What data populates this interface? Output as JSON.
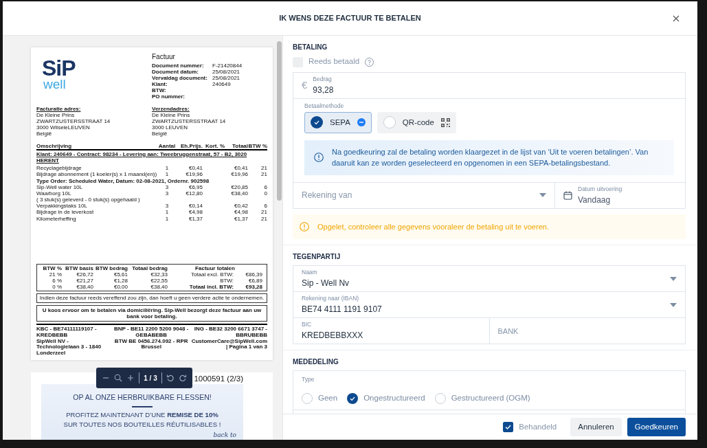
{
  "modal": {
    "title": "IK WENS DEZE FACTUUR TE BETALEN"
  },
  "invoice": {
    "logo": {
      "wordmark": "SiP",
      "tagline": "well"
    },
    "title": "Factuur",
    "meta": [
      {
        "label": "Document nummer:",
        "value": "F-21420844"
      },
      {
        "label": "Document datum:",
        "value": "25/08/2021"
      },
      {
        "label": "Vervaldag document:",
        "value": "25/08/2021"
      },
      {
        "label": "Klant:",
        "value": "240649"
      },
      {
        "label": "BTW:"
      },
      {
        "label": "PO nummer:"
      }
    ],
    "billing_address": {
      "heading": "Facturatie adres:",
      "lines": [
        "De Kleine Prins",
        "ZWARTZUSTERSSTRAAT 14",
        "3000 WilseleLEUVEN",
        "België"
      ]
    },
    "shipping_address": {
      "heading": "Verzendadres:",
      "lines": [
        "De Kleine Prins",
        "ZWARTZUSTERSSTRAAT 14",
        "3000 LEUVEN",
        "België"
      ]
    },
    "table": {
      "columns": [
        "Omschrijving",
        "Aantal",
        "Eh.Prijs.",
        "Kort. %",
        "Totaal",
        "BTW %"
      ],
      "rows": [
        {
          "kind": "group",
          "text": "Klant: 240649 - Contract: 98234 - Levering aan: Tweebruggenstraat, 57 - B2, 3020 HERENT"
        },
        {
          "kind": "item",
          "description": "Recyclagebijdrage",
          "quantity": "1",
          "unit_price": "€0,41",
          "total": "€0,41",
          "vat": "21"
        },
        {
          "kind": "item",
          "description": "Bijdrage abonnement (1 koeler(s) x 1 maand(en))",
          "quantity": "1",
          "unit_price": "€19,96",
          "total": "€19,96",
          "vat": "21"
        },
        {
          "kind": "order",
          "text": "Type Order: Scheduled Water, Datum: 02-08-2021, Ordernr. 902598"
        },
        {
          "kind": "item",
          "description": "Sip-Well water 10L",
          "quantity": "3",
          "unit_price": "€6,95",
          "total": "€20,85",
          "vat": "6"
        },
        {
          "kind": "item",
          "description": "Waarborg 10L",
          "note": "( 3 stuk(s) geleverd - 0 stuk(s) opgehaald )",
          "quantity": "3",
          "unit_price": "€12,80",
          "total": "€38,40",
          "vat": "0"
        },
        {
          "kind": "item",
          "description": "Verpakkingstaks 10L",
          "quantity": "3",
          "unit_price": "€0,14",
          "total": "€0,42",
          "vat": "6"
        },
        {
          "kind": "item",
          "description": "Bijdrage in de leverkost",
          "quantity": "1",
          "unit_price": "€4,98",
          "total": "€4,98",
          "vat": "21"
        },
        {
          "kind": "item",
          "description": "Kilometerheffing",
          "quantity": "1",
          "unit_price": "€1,37",
          "total": "€1,37",
          "vat": "21"
        }
      ]
    },
    "vat_summary": {
      "columns": [
        "BTW %",
        "BTW basis",
        "BTW bedrag",
        "Totaal bedrag"
      ],
      "rows": [
        [
          "21 %",
          "€26,72",
          "€5,61",
          "€32,33"
        ],
        [
          "6 %",
          "€21,27",
          "€1,28",
          "€22,55"
        ],
        [
          "0 %",
          "€38,40",
          "€0,00",
          "€38,40"
        ]
      ]
    },
    "totals": {
      "heading": "Factuur totalen",
      "lines": [
        {
          "kind": "line",
          "label": "Totaal excl. BTW:",
          "value": "€86,39"
        },
        {
          "kind": "line",
          "label": "BTW:",
          "value": "€6,89"
        },
        {
          "kind": "total",
          "label": "Totaal incl. BTW:",
          "value": "€93,28"
        }
      ]
    },
    "notice": "Indien deze factuur reeds vereffend zou zijn, dan hoeft u geen verdere actie te ondernemen.",
    "payment_note": "U koos ervoor om te betalen via domiciliëring. Sip-Well bezorgt deze factuur aan uw bank voor betaling.",
    "footer": [
      [
        "KBC - BE74111119107 - KREDBEBB",
        "BNP - BE11 2200 5200 9048 - GEBABEBB",
        "ING - BE32 3200 6671 3747 - BBRUBEBB"
      ],
      [
        "SipWell NV - Technologielaan 3 - 1840 Londerzeel",
        "BTW BE 0456.274.092 - RPR Brussel",
        "CustomerCare@SipWell.com | Pagina  1   van  3"
      ]
    ]
  },
  "page_two": {
    "header": "1000591 (2/3)",
    "banner": [
      "OP AL ONZE HERBRUIKBARE FLESSEN!",
      "PROFITEZ MAINTENANT D’UNE **REMISE DE 10%**",
      "SUR TOUTES NOS BOUTEILLES RÉUTILISABLES !"
    ],
    "script_text": "back to"
  },
  "viewer_toolbar": {
    "page_indicator": "1 / 3"
  },
  "payment": {
    "heading": "BETALING",
    "already_paid": {
      "label": "Reeds betaald",
      "checked": false,
      "disabled": true
    },
    "amount": {
      "currency": "€",
      "label": "Bedrag",
      "value": "93,28"
    },
    "method": {
      "label": "Betaalmethode",
      "options": [
        {
          "kind": "sepa",
          "label": "SEPA",
          "selected": true
        },
        {
          "kind": "qr",
          "label": "QR-code",
          "selected": false
        }
      ]
    },
    "info": "Na goedkeuring zal de betaling worden klaargezet in de lijst van ‘Uit te voeren betalingen’. Van daaruit kan ze worden geselecteerd en opgenomen in een SEPA-betalingsbestand.",
    "account_from": {
      "placeholder": "Rekening van"
    },
    "execution_date": {
      "label": "Datum uitvoering",
      "value": "Vandaag"
    },
    "warning": "Opgelet, controleer alle gegevens vooraleer de betaling uit te voeren."
  },
  "counterparty": {
    "heading": "TEGENPARTIJ",
    "name": {
      "label": "Naam",
      "value": "Sip - Well Nv"
    },
    "iban": {
      "label": "Rekening naar (IBAN)",
      "value": "BE74 4111 1191 9107"
    },
    "bic": {
      "label": "BIC",
      "value": "KREDBEBBXXX"
    },
    "bank": {
      "placeholder": "BANK"
    }
  },
  "message": {
    "heading": "MEDEDELING",
    "type_label": "Type",
    "types": [
      {
        "label": "Geen",
        "selected": false
      },
      {
        "label": "Ongestructureerd",
        "selected": true
      },
      {
        "label": "Gestructureerd (OGM)",
        "selected": false
      }
    ]
  },
  "footer": {
    "handled": {
      "label": "Behandeld",
      "checked": true
    },
    "buttons": [
      {
        "kind": "secondary",
        "label": "Annuleren"
      },
      {
        "kind": "primary",
        "label": "Goedkeuren"
      }
    ]
  }
}
